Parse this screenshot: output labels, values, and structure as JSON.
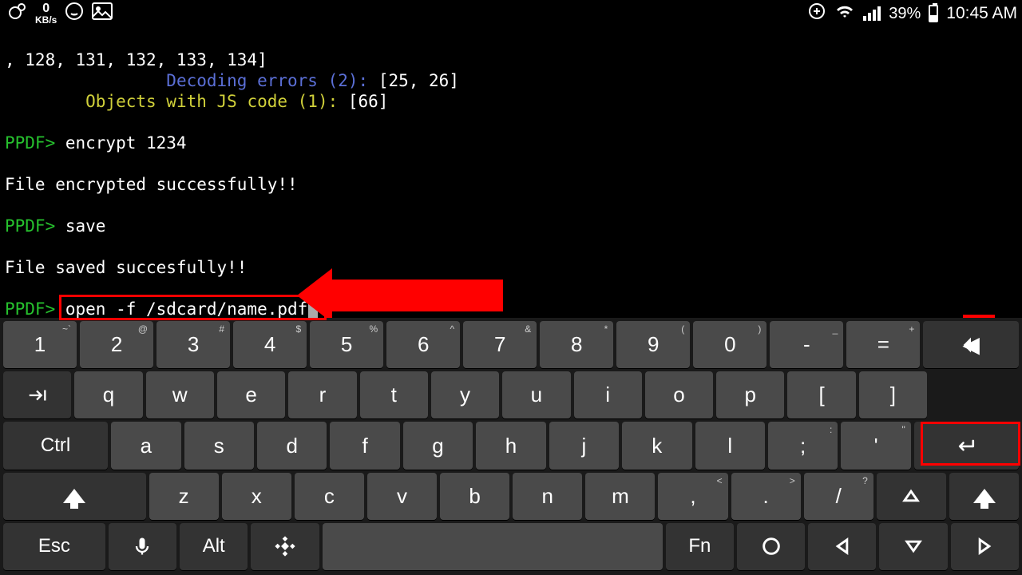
{
  "status": {
    "kbs_value": "0",
    "kbs_unit": "KB/s",
    "battery_pct": "39%",
    "battery_fill_pct": 39,
    "time": "10:45 AM"
  },
  "terminal": {
    "line_ids": ", 128, 131, 132, 133, 134]",
    "decoding_label": "Decoding errors (2):",
    "decoding_val": " [25, 26]",
    "js_label": "Objects with JS code (1):",
    "js_val": " [66]",
    "prompt": "PPDF>",
    "cmd_encrypt": " encrypt 1234",
    "msg_encrypted": "File encrypted successfully!!",
    "cmd_save": " save",
    "msg_saved": "File saved succesfully!!",
    "cmd_open": " open -f /sdcard/name.pdf"
  },
  "keyboard": {
    "row1": [
      {
        "label": "1",
        "sup": "~`"
      },
      {
        "label": "2",
        "sup": "@"
      },
      {
        "label": "3",
        "sup": "#"
      },
      {
        "label": "4",
        "sup": "$"
      },
      {
        "label": "5",
        "sup": "%"
      },
      {
        "label": "6",
        "sup": "^"
      },
      {
        "label": "7",
        "sup": "&"
      },
      {
        "label": "8",
        "sup": "*"
      },
      {
        "label": "9",
        "sup": "("
      },
      {
        "label": "0",
        "sup": ")"
      },
      {
        "label": "-",
        "sup": "_"
      },
      {
        "label": "=",
        "sup": "+"
      }
    ],
    "row2": [
      {
        "label": "q"
      },
      {
        "label": "w"
      },
      {
        "label": "e"
      },
      {
        "label": "r"
      },
      {
        "label": "t"
      },
      {
        "label": "y"
      },
      {
        "label": "u"
      },
      {
        "label": "i"
      },
      {
        "label": "o"
      },
      {
        "label": "p"
      },
      {
        "label": "["
      },
      {
        "label": "]"
      }
    ],
    "row3": [
      {
        "label": "a"
      },
      {
        "label": "s"
      },
      {
        "label": "d"
      },
      {
        "label": "f"
      },
      {
        "label": "g"
      },
      {
        "label": "h"
      },
      {
        "label": "j"
      },
      {
        "label": "k"
      },
      {
        "label": "l"
      },
      {
        "label": ";",
        "sup": ":"
      },
      {
        "label": "'",
        "sup": "\""
      }
    ],
    "row4": [
      {
        "label": "z"
      },
      {
        "label": "x"
      },
      {
        "label": "c"
      },
      {
        "label": "v"
      },
      {
        "label": "b"
      },
      {
        "label": "n"
      },
      {
        "label": "m"
      },
      {
        "label": ",",
        "sup": "<"
      },
      {
        "label": ".",
        "sup": ">"
      },
      {
        "label": "/",
        "sup": "?"
      }
    ],
    "ctrl": "Ctrl",
    "esc": "Esc",
    "alt": "Alt",
    "fn": "Fn"
  }
}
